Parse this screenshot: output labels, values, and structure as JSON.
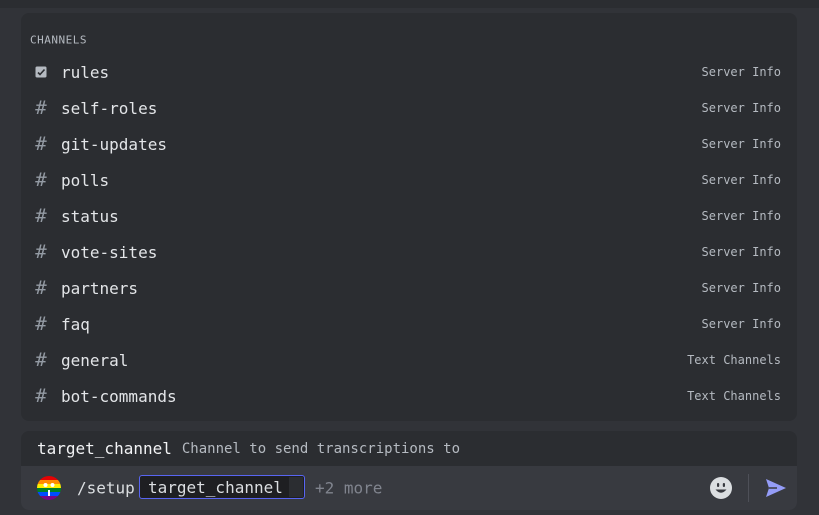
{
  "popup": {
    "header": "CHANNELS",
    "channels": [
      {
        "name": "rules",
        "category": "Server Info",
        "icon": "rules-icon"
      },
      {
        "name": "self-roles",
        "category": "Server Info",
        "icon": "hash-icon"
      },
      {
        "name": "git-updates",
        "category": "Server Info",
        "icon": "hash-icon"
      },
      {
        "name": "polls",
        "category": "Server Info",
        "icon": "hash-icon"
      },
      {
        "name": "status",
        "category": "Server Info",
        "icon": "hash-icon"
      },
      {
        "name": "vote-sites",
        "category": "Server Info",
        "icon": "hash-icon"
      },
      {
        "name": "partners",
        "category": "Server Info",
        "icon": "hash-icon"
      },
      {
        "name": "faq",
        "category": "Server Info",
        "icon": "hash-icon"
      },
      {
        "name": "general",
        "category": "Text Channels",
        "icon": "hash-icon"
      },
      {
        "name": "bot-commands",
        "category": "Text Channels",
        "icon": "hash-icon"
      }
    ]
  },
  "option_hint": {
    "name": "target_channel",
    "description": "Channel to send transcriptions to"
  },
  "composer": {
    "command": "/setup",
    "option_label": "target_channel",
    "more": "+2 more",
    "emoji_icon": "smile-icon",
    "send_icon": "send-icon"
  },
  "colors": {
    "background": "#313338",
    "popup": "#2b2d31",
    "composer": "#383a40",
    "accent": "#5865f2"
  }
}
